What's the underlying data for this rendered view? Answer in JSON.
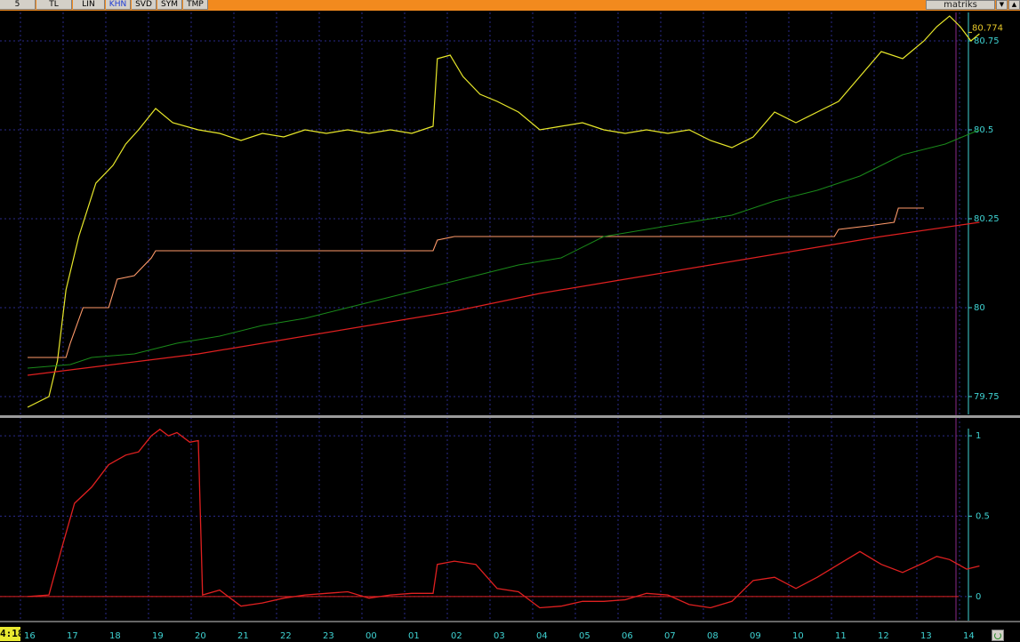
{
  "toolbar": {
    "buttons": [
      {
        "label": "5"
      },
      {
        "label": "TL"
      },
      {
        "label": "LIN"
      },
      {
        "label": "KHN",
        "active": true
      },
      {
        "label": "SVD"
      },
      {
        "label": "SYM"
      },
      {
        "label": "TMP"
      }
    ],
    "brand": "matriks"
  },
  "status": {
    "time": "4:18"
  },
  "colors": {
    "price": "#e8e82a",
    "orange": "#ff9a6a",
    "green": "#1a8a1a",
    "red": "#e02020",
    "grid": "#2a2a8a",
    "axis": "#3fd3d3",
    "lastpx": "#e8c82a",
    "divider": "#9a9a9a",
    "cursor": "#8a2a8a"
  },
  "chart_data": [
    {
      "type": "line",
      "panel": "price",
      "x_labels": [
        "16",
        "17",
        "18",
        "19",
        "20",
        "21",
        "22",
        "23",
        "00",
        "01",
        "02",
        "03",
        "04",
        "05",
        "06",
        "07",
        "08",
        "09",
        "10",
        "11",
        "12",
        "13",
        "14"
      ],
      "y_ticks": [
        79.75,
        80,
        80.25,
        80.5,
        80.75
      ],
      "ylim": [
        79.7,
        80.83
      ],
      "last_value": "80.774",
      "series": [
        {
          "values": [
            [
              0,
              79.72
            ],
            [
              0.5,
              79.75
            ],
            [
              0.7,
              79.85
            ],
            [
              0.9,
              80.05
            ],
            [
              1.2,
              80.2
            ],
            [
              1.6,
              80.35
            ],
            [
              2.0,
              80.4
            ],
            [
              2.3,
              80.46
            ],
            [
              2.6,
              80.5
            ],
            [
              2.8,
              80.53
            ],
            [
              3.0,
              80.56
            ],
            [
              3.4,
              80.52
            ],
            [
              4.0,
              80.5
            ],
            [
              4.5,
              80.49
            ],
            [
              5.0,
              80.47
            ],
            [
              5.5,
              80.49
            ],
            [
              6.0,
              80.48
            ],
            [
              6.5,
              80.5
            ],
            [
              7.0,
              80.49
            ],
            [
              7.5,
              80.5
            ],
            [
              8.0,
              80.49
            ],
            [
              8.5,
              80.5
            ],
            [
              9.0,
              80.49
            ],
            [
              9.5,
              80.51
            ],
            [
              9.6,
              80.7
            ],
            [
              9.9,
              80.71
            ],
            [
              10.2,
              80.65
            ],
            [
              10.6,
              80.6
            ],
            [
              11.0,
              80.58
            ],
            [
              11.5,
              80.55
            ],
            [
              12.0,
              80.5
            ],
            [
              12.5,
              80.51
            ],
            [
              13.0,
              80.52
            ],
            [
              13.5,
              80.5
            ],
            [
              14.0,
              80.49
            ],
            [
              14.5,
              80.5
            ],
            [
              15.0,
              80.49
            ],
            [
              15.5,
              80.5
            ],
            [
              16.0,
              80.47
            ],
            [
              16.5,
              80.45
            ],
            [
              17.0,
              80.48
            ],
            [
              17.5,
              80.55
            ],
            [
              18.0,
              80.52
            ],
            [
              18.5,
              80.55
            ],
            [
              19.0,
              80.58
            ],
            [
              19.5,
              80.65
            ],
            [
              20.0,
              80.72
            ],
            [
              20.5,
              80.7
            ],
            [
              21.0,
              80.75
            ],
            [
              21.3,
              80.79
            ],
            [
              21.6,
              80.82
            ],
            [
              21.85,
              80.79
            ],
            [
              22.1,
              80.75
            ],
            [
              22.3,
              80.77
            ]
          ]
        },
        {
          "values": [
            [
              0,
              79.86
            ],
            [
              0.9,
              79.86
            ],
            [
              1.0,
              79.9
            ],
            [
              1.3,
              80.0
            ],
            [
              1.9,
              80.0
            ],
            [
              2.1,
              80.08
            ],
            [
              2.5,
              80.09
            ],
            [
              2.9,
              80.14
            ],
            [
              3.0,
              80.16
            ],
            [
              9.5,
              80.16
            ],
            [
              9.6,
              80.19
            ],
            [
              10.0,
              80.2
            ],
            [
              13.0,
              80.2
            ],
            [
              18.9,
              80.2
            ],
            [
              19.0,
              80.22
            ],
            [
              19.7,
              80.23
            ],
            [
              20.3,
              80.24
            ],
            [
              20.4,
              80.28
            ],
            [
              21.0,
              80.28
            ]
          ]
        },
        {
          "values": [
            [
              0,
              79.83
            ],
            [
              1.0,
              79.84
            ],
            [
              1.5,
              79.86
            ],
            [
              2.5,
              79.87
            ],
            [
              3.5,
              79.9
            ],
            [
              4.5,
              79.92
            ],
            [
              5.5,
              79.95
            ],
            [
              6.5,
              79.97
            ],
            [
              7.5,
              80.0
            ],
            [
              8.5,
              80.03
            ],
            [
              9.5,
              80.06
            ],
            [
              10.5,
              80.09
            ],
            [
              11.5,
              80.12
            ],
            [
              12.5,
              80.14
            ],
            [
              13.5,
              80.2
            ],
            [
              14.5,
              80.22
            ],
            [
              15.5,
              80.24
            ],
            [
              16.5,
              80.26
            ],
            [
              17.5,
              80.3
            ],
            [
              18.5,
              80.33
            ],
            [
              19.5,
              80.37
            ],
            [
              20.5,
              80.43
            ],
            [
              21.5,
              80.46
            ],
            [
              22.3,
              80.5
            ]
          ]
        },
        {
          "values": [
            [
              0,
              79.81
            ],
            [
              2,
              79.84
            ],
            [
              4,
              79.87
            ],
            [
              6,
              79.91
            ],
            [
              8,
              79.95
            ],
            [
              10,
              79.99
            ],
            [
              12,
              80.04
            ],
            [
              14,
              80.08
            ],
            [
              16,
              80.12
            ],
            [
              18,
              80.16
            ],
            [
              20,
              80.2
            ],
            [
              22.3,
              80.24
            ]
          ]
        }
      ]
    },
    {
      "type": "line",
      "panel": "indicator",
      "y_ticks": [
        0,
        0.5,
        1
      ],
      "ylim": [
        -0.15,
        1.1
      ],
      "series": [
        {
          "values": [
            [
              0,
              0
            ],
            [
              0.5,
              0.01
            ],
            [
              0.8,
              0.3
            ],
            [
              1.1,
              0.58
            ],
            [
              1.5,
              0.68
            ],
            [
              1.9,
              0.82
            ],
            [
              2.3,
              0.88
            ],
            [
              2.6,
              0.9
            ],
            [
              2.9,
              1.0
            ],
            [
              3.1,
              1.04
            ],
            [
              3.3,
              1.0
            ],
            [
              3.5,
              1.02
            ],
            [
              3.8,
              0.96
            ],
            [
              4.0,
              0.97
            ],
            [
              4.1,
              0.01
            ],
            [
              4.5,
              0.04
            ],
            [
              5.0,
              -0.06
            ],
            [
              5.5,
              -0.04
            ],
            [
              6.0,
              -0.01
            ],
            [
              6.5,
              0.01
            ],
            [
              7.0,
              0.02
            ],
            [
              7.5,
              0.03
            ],
            [
              8.0,
              -0.01
            ],
            [
              8.5,
              0.01
            ],
            [
              9.0,
              0.02
            ],
            [
              9.5,
              0.02
            ],
            [
              9.6,
              0.2
            ],
            [
              10.0,
              0.22
            ],
            [
              10.5,
              0.2
            ],
            [
              11.0,
              0.05
            ],
            [
              11.5,
              0.03
            ],
            [
              12.0,
              -0.07
            ],
            [
              12.5,
              -0.06
            ],
            [
              13.0,
              -0.03
            ],
            [
              13.5,
              -0.03
            ],
            [
              14.0,
              -0.02
            ],
            [
              14.5,
              0.02
            ],
            [
              15.0,
              0.01
            ],
            [
              15.5,
              -0.05
            ],
            [
              16.0,
              -0.07
            ],
            [
              16.5,
              -0.03
            ],
            [
              17.0,
              0.1
            ],
            [
              17.5,
              0.12
            ],
            [
              18.0,
              0.05
            ],
            [
              18.5,
              0.12
            ],
            [
              19.0,
              0.2
            ],
            [
              19.5,
              0.28
            ],
            [
              20.0,
              0.2
            ],
            [
              20.5,
              0.15
            ],
            [
              21.0,
              0.21
            ],
            [
              21.3,
              0.25
            ],
            [
              21.6,
              0.23
            ],
            [
              22.0,
              0.17
            ],
            [
              22.3,
              0.19
            ]
          ]
        }
      ]
    }
  ]
}
